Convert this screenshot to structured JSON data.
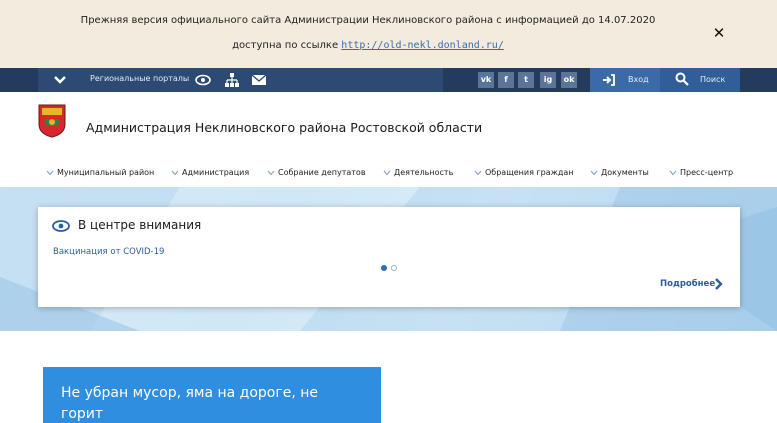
{
  "notice": {
    "line1": "Прежняя версия официального сайта Администрации Неклиновского района с информацией до 14.07.2020",
    "line2_prefix": "доступна по ссылке",
    "link": "http://old-nekl.donland.ru/",
    "close_icon": "close-icon"
  },
  "topbar": {
    "portals_label": "Региональные порталы",
    "icons": [
      "chevron-down-icon",
      "eye-icon",
      "sitemap-icon",
      "envelope-icon"
    ],
    "social": [
      {
        "label": "vk",
        "icon": "vk-icon"
      },
      {
        "label": "f",
        "icon": "facebook-icon"
      },
      {
        "label": "t",
        "icon": "twitter-icon"
      },
      {
        "label": "ig",
        "icon": "instagram-icon"
      },
      {
        "label": "ok",
        "icon": "odnoklassniki-icon"
      }
    ],
    "login_label": "Вход",
    "search_label": "Поиск"
  },
  "header": {
    "title": "Администрация Неклиновского района Ростовской области"
  },
  "nav": {
    "items": [
      "Муниципальный район",
      "Администрация",
      "Собрание депутатов",
      "Деятельность",
      "Обращения граждан",
      "Документы",
      "Пресс-центр"
    ]
  },
  "card": {
    "title": "В центре внимания",
    "link": "Вакцинация от COVID-19",
    "more": "Подробнее",
    "slides_total": 2,
    "slide_active": 1
  },
  "promo": {
    "text": "Не убран мусор, яма на дороге, не горит"
  },
  "colors": {
    "topbar": "#233b5d",
    "accent": "#2f8ee0",
    "link": "#2b5e9e"
  }
}
